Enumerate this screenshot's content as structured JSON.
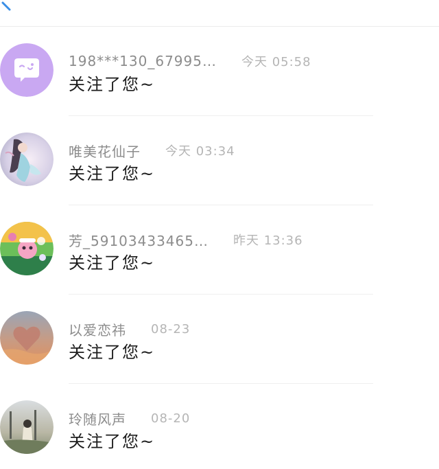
{
  "header": {
    "back_icon": "back-arrow-icon",
    "accent_color": "#3a8ee6"
  },
  "notifications": [
    {
      "name": "198***130_67995…",
      "time": "今天 05:58",
      "message": "关注了您~",
      "avatar": "chat-bubble-icon",
      "avatar_color": "#c9a8f2"
    },
    {
      "name": "唯美花仙子",
      "time": "今天 03:34",
      "message": "关注了您~",
      "avatar": "user-avatar-fairy"
    },
    {
      "name": "芳_59103433465…",
      "time": "昨天 13:36",
      "message": "关注了您~",
      "avatar": "user-avatar-cartoon"
    },
    {
      "name": "以爱恋祎",
      "time": "08-23",
      "message": "关注了您~",
      "avatar": "user-avatar-heart-sky"
    },
    {
      "name": "玲随风声",
      "time": "08-20",
      "message": "关注了您~",
      "avatar": "user-avatar-photo"
    }
  ]
}
